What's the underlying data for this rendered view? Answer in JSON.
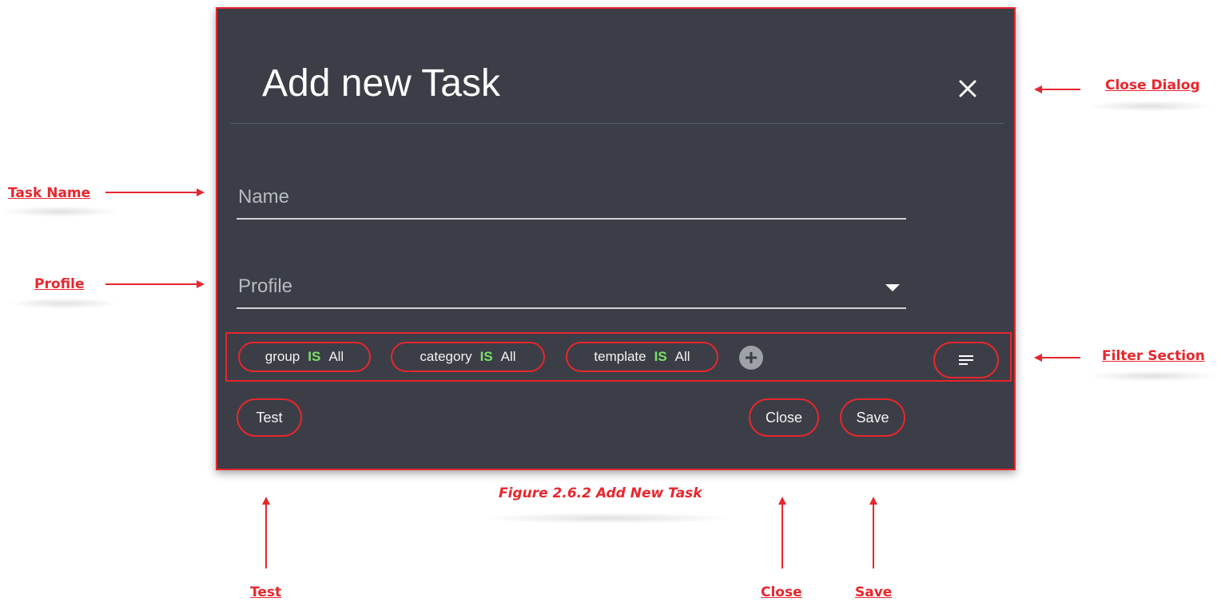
{
  "dialog": {
    "title": "Add new Task",
    "fields": {
      "name_placeholder": "Name",
      "profile_placeholder": "Profile"
    },
    "filters": [
      {
        "field": "group",
        "operator": "IS",
        "value": "All"
      },
      {
        "field": "category",
        "operator": "IS",
        "value": "All"
      },
      {
        "field": "template",
        "operator": "IS",
        "value": "All"
      }
    ],
    "buttons": {
      "test": "Test",
      "close": "Close",
      "save": "Save"
    }
  },
  "annotations": {
    "close_dialog": "Close Dialog",
    "task_name": "Task Name",
    "profile": "Profile",
    "filter_section": "Filter Section",
    "test": "Test",
    "close": "Close",
    "save": "Save"
  },
  "caption": "Figure 2.6.2 Add New Task",
  "colors": {
    "dialog_bg": "#3b3e46",
    "annotation_red": "#e8262d",
    "operator_green": "#7ee06a"
  },
  "icons": {
    "close": "close-icon",
    "dropdown": "chevron-down-icon",
    "add_filter": "plus-circle-icon",
    "sort": "sort-lines-icon"
  }
}
